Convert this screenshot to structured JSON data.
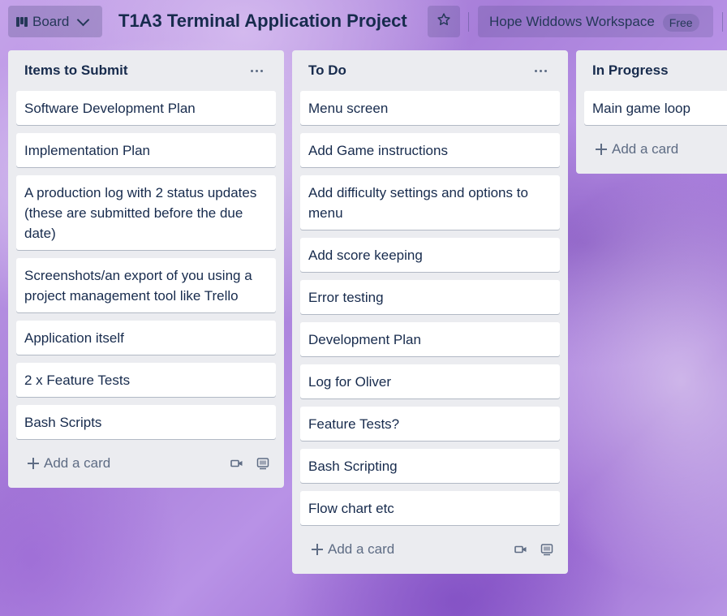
{
  "header": {
    "view_label": "Board",
    "board_title": "T1A3 Terminal Application Project",
    "workspace_name": "Hope Widdows Workspace",
    "workspace_badge": "Free"
  },
  "lists": [
    {
      "title": "Items to Submit",
      "cards": [
        "Software Development Plan",
        "Implementation Plan",
        "A production log with 2 status updates (these are submitted before the due date)",
        "Screenshots/an export of you using a project management tool like Trello",
        "Application itself",
        "2 x Feature Tests",
        "Bash Scripts"
      ],
      "add_card_label": "Add a card"
    },
    {
      "title": "To Do",
      "cards": [
        "Menu screen",
        "Add Game instructions",
        "Add difficulty settings and options to menu",
        "Add score keeping",
        "Error testing",
        "Development Plan",
        "Log for Oliver",
        "Feature Tests?",
        "Bash Scripting",
        "Flow chart etc"
      ],
      "add_card_label": "Add a card"
    },
    {
      "title": "In Progress",
      "cards": [
        "Main game loop"
      ],
      "add_card_label": "Add a card"
    }
  ],
  "icons": {
    "board_view": "board-icon",
    "view_dropdown": "chevron-down-icon",
    "star": "star-icon",
    "list_menu": "more-icon",
    "add": "plus-icon",
    "template": "template-icon",
    "card_template": "card-template-icon"
  }
}
